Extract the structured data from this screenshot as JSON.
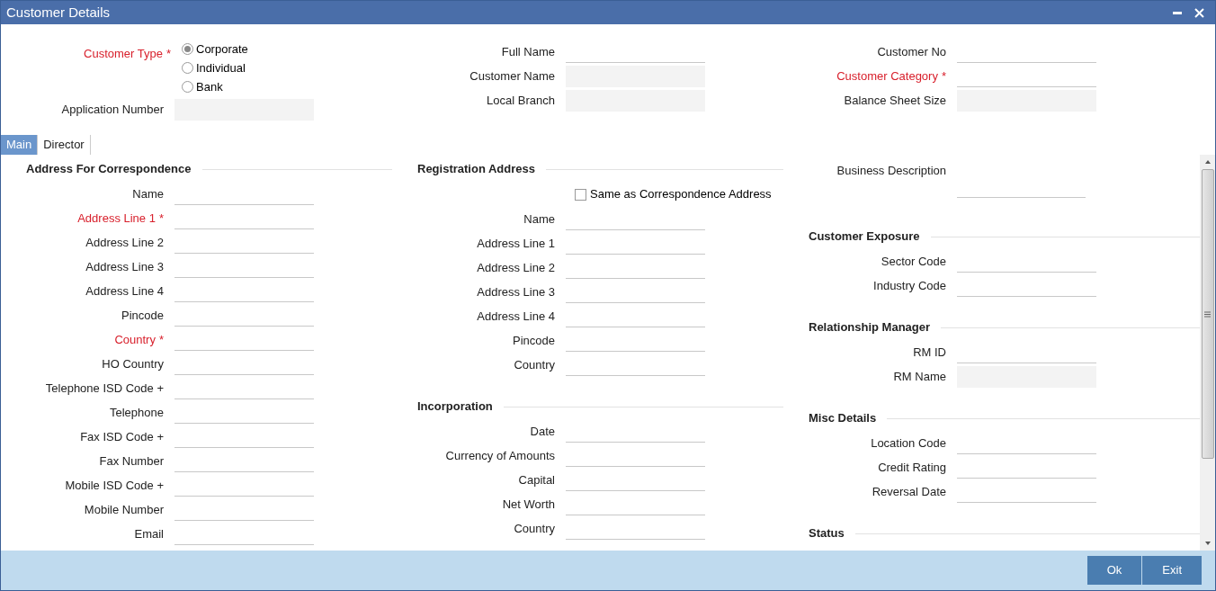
{
  "window": {
    "title": "Customer Details"
  },
  "header": {
    "customer_type": {
      "label": "Customer Type",
      "required": true,
      "required_mark": "*",
      "options": [
        {
          "label": "Corporate",
          "selected": true
        },
        {
          "label": "Individual",
          "selected": false
        },
        {
          "label": "Bank",
          "selected": false
        }
      ]
    },
    "application_number": {
      "label": "Application Number",
      "required": false,
      "disabled": true
    },
    "column_2": [
      {
        "label": "Full Name",
        "required": false,
        "disabled": false
      },
      {
        "label": "Customer Name",
        "required": false,
        "disabled": true
      },
      {
        "label": "Local Branch",
        "required": false,
        "disabled": true
      }
    ],
    "column_3": [
      {
        "label": "Customer No",
        "required": false,
        "disabled": false
      },
      {
        "label": "Customer Category",
        "required": true,
        "required_mark": "*",
        "disabled": false
      },
      {
        "label": "Balance Sheet Size",
        "required": false,
        "disabled": true
      }
    ]
  },
  "tabs": [
    {
      "label": "Main",
      "selected": true
    },
    {
      "label": "Director",
      "selected": false
    }
  ],
  "columns": [
    [
      {
        "title": "Address For Correspondence",
        "items": [
          {
            "kind": "field",
            "label": "Name",
            "required": false,
            "disabled": false
          },
          {
            "kind": "field",
            "label": "Address Line 1",
            "required": true,
            "required_mark": "*",
            "disabled": false
          },
          {
            "kind": "field",
            "label": "Address Line 2",
            "required": false,
            "disabled": false
          },
          {
            "kind": "field",
            "label": "Address Line 3",
            "required": false,
            "disabled": false
          },
          {
            "kind": "field",
            "label": "Address Line 4",
            "required": false,
            "disabled": false
          },
          {
            "kind": "field",
            "label": "Pincode",
            "required": false,
            "disabled": false
          },
          {
            "kind": "field",
            "label": "Country",
            "required": true,
            "required_mark": "*",
            "disabled": false
          },
          {
            "kind": "field",
            "label": "HO Country",
            "required": false,
            "disabled": false
          },
          {
            "kind": "field",
            "label": "Telephone ISD Code +",
            "required": false,
            "disabled": false
          },
          {
            "kind": "field",
            "label": "Telephone",
            "required": false,
            "disabled": false
          },
          {
            "kind": "field",
            "label": "Fax ISD Code +",
            "required": false,
            "disabled": false
          },
          {
            "kind": "field",
            "label": "Fax Number",
            "required": false,
            "disabled": false
          },
          {
            "kind": "field",
            "label": "Mobile ISD Code +",
            "required": false,
            "disabled": false
          },
          {
            "kind": "field",
            "label": "Mobile Number",
            "required": false,
            "disabled": false
          },
          {
            "kind": "field",
            "label": "Email",
            "required": false,
            "disabled": false
          }
        ]
      }
    ],
    [
      {
        "title": "Registration Address",
        "items": [
          {
            "kind": "checkbox",
            "label": "Same as Correspondence Address",
            "checked": false
          },
          {
            "kind": "field",
            "label": "Name",
            "required": false,
            "disabled": false
          },
          {
            "kind": "field",
            "label": "Address Line 1",
            "required": false,
            "disabled": false
          },
          {
            "kind": "field",
            "label": "Address Line 2",
            "required": false,
            "disabled": false
          },
          {
            "kind": "field",
            "label": "Address Line 3",
            "required": false,
            "disabled": false
          },
          {
            "kind": "field",
            "label": "Address Line 4",
            "required": false,
            "disabled": false
          },
          {
            "kind": "field",
            "label": "Pincode",
            "required": false,
            "disabled": false
          },
          {
            "kind": "field",
            "label": "Country",
            "required": false,
            "disabled": false
          }
        ]
      },
      {
        "title": "Incorporation",
        "items": [
          {
            "kind": "field",
            "label": "Date",
            "required": false,
            "disabled": false
          },
          {
            "kind": "field",
            "label": "Currency of Amounts",
            "required": false,
            "disabled": false
          },
          {
            "kind": "field",
            "label": "Capital",
            "required": false,
            "disabled": false
          },
          {
            "kind": "field",
            "label": "Net Worth",
            "required": false,
            "disabled": false
          },
          {
            "kind": "field",
            "label": "Country",
            "required": false,
            "disabled": false
          }
        ]
      }
    ],
    [
      {
        "items": [
          {
            "kind": "textarea",
            "label": "Business Description",
            "required": false,
            "disabled": false
          }
        ]
      },
      {
        "title": "Customer Exposure",
        "items": [
          {
            "kind": "field",
            "label": "Sector Code",
            "required": false,
            "disabled": false
          },
          {
            "kind": "field",
            "label": "Industry Code",
            "required": false,
            "disabled": false
          }
        ]
      },
      {
        "title": "Relationship Manager",
        "items": [
          {
            "kind": "field",
            "label": "RM ID",
            "required": false,
            "disabled": false
          },
          {
            "kind": "field",
            "label": "RM Name",
            "required": false,
            "disabled": true
          }
        ]
      },
      {
        "title": "Misc Details",
        "items": [
          {
            "kind": "field",
            "label": "Location Code",
            "required": false,
            "disabled": false
          },
          {
            "kind": "field",
            "label": "Credit Rating",
            "required": false,
            "disabled": false
          },
          {
            "kind": "field",
            "label": "Reversal Date",
            "required": false,
            "disabled": false
          }
        ]
      },
      {
        "title": "Status"
      }
    ]
  ],
  "buttons": [
    "Ok",
    "Exit"
  ]
}
